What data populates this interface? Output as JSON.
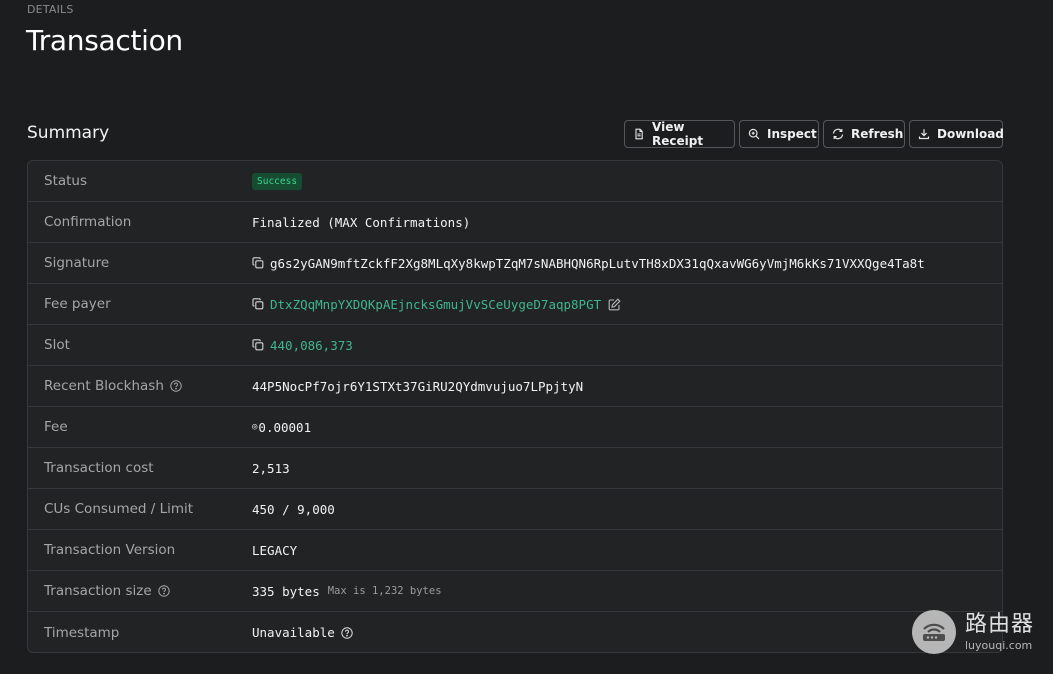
{
  "header": {
    "eyebrow": "DETAILS",
    "title": "Transaction"
  },
  "summary": {
    "title": "Summary",
    "buttons": {
      "view_receipt": "View Receipt",
      "inspect": "Inspect",
      "refresh": "Refresh",
      "download": "Download"
    }
  },
  "rows": {
    "status": {
      "label": "Status",
      "value": "Success"
    },
    "confirmation": {
      "label": "Confirmation",
      "value": "Finalized (MAX Confirmations)"
    },
    "signature": {
      "label": "Signature",
      "value": "g6s2yGAN9mftZckfF2Xg8MLqXy8kwpTZqM7sNABHQN6RpLutvTH8xDX31qQxavWG6yVmjM6kKs71VXXQge4Ta8t"
    },
    "fee_payer": {
      "label": "Fee payer",
      "value": "DtxZQqMnpYXDQKpAEjncksGmujVvSCeUygeD7aqp8PGT"
    },
    "slot": {
      "label": "Slot",
      "value": "440,086,373"
    },
    "recent_blockhash": {
      "label": "Recent Blockhash",
      "value": "44P5NocPf7ojr6Y1STXt37GiRU2QYdmvujuo7LPpjtyN"
    },
    "fee": {
      "label": "Fee",
      "symbol": "◎",
      "value": "0.00001"
    },
    "transaction_cost": {
      "label": "Transaction cost",
      "value": "2,513"
    },
    "cus": {
      "label": "CUs Consumed / Limit",
      "value": "450 / 9,000"
    },
    "transaction_version": {
      "label": "Transaction Version",
      "value": "LEGACY"
    },
    "transaction_size": {
      "label": "Transaction size",
      "value": "335 bytes",
      "note": "Max is 1,232 bytes"
    },
    "timestamp": {
      "label": "Timestamp",
      "value": "Unavailable"
    }
  },
  "watermark": {
    "cn": "路由器",
    "en": "luyouqi.com"
  },
  "colors": {
    "background": "#1c1d1f",
    "card": "#222325",
    "border": "#35373a",
    "link": "#3fb68b",
    "success_badge_bg": "#164c31",
    "success_badge_text": "#3cd48f"
  }
}
